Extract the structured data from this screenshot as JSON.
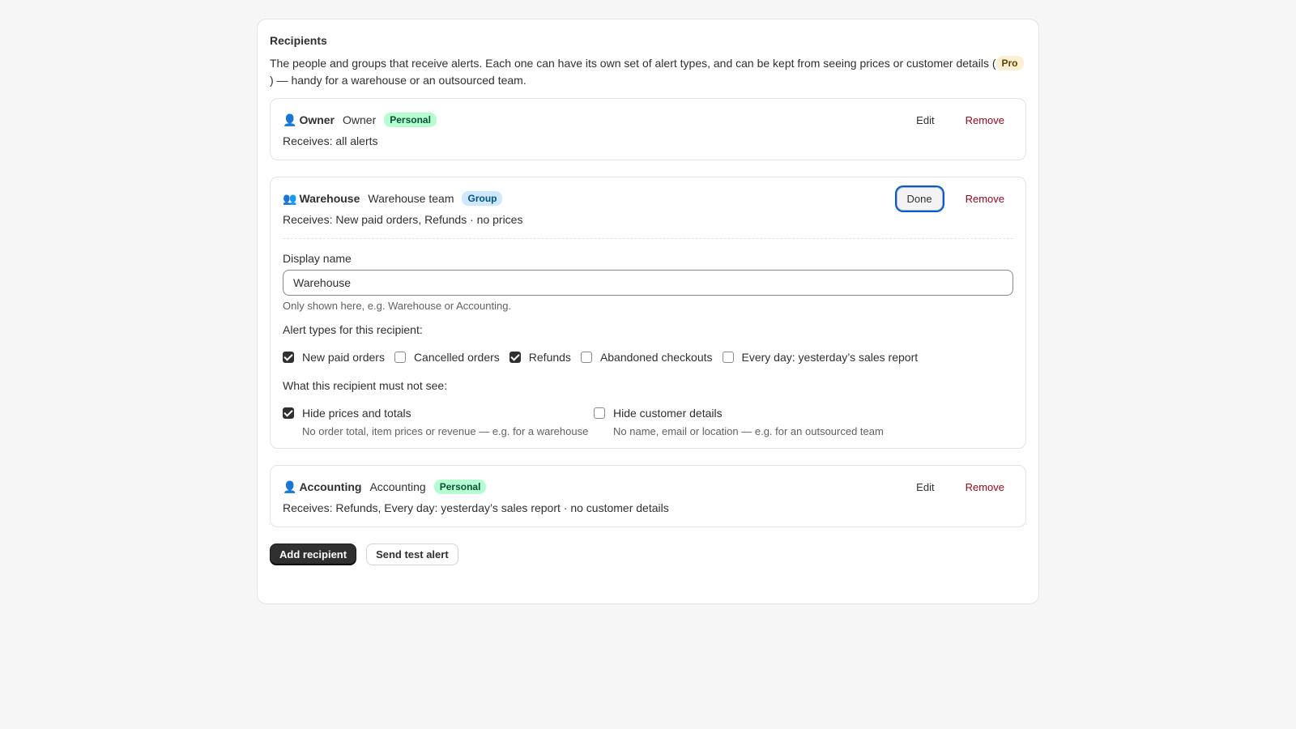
{
  "section": {
    "title": "Recipients",
    "description_before": "The people and groups that receive alerts. Each one can have its own set of alert types, and can be kept from seeing prices or customer details (",
    "pro_badge": "Pro",
    "description_after": ") — handy for a warehouse or an outsourced team."
  },
  "recipients": [
    {
      "icon": "👤",
      "name": "Owner",
      "subtitle": "Owner",
      "badge": "Personal",
      "receives": "Receives: all alerts",
      "edit_label": "Edit",
      "remove_label": "Remove"
    },
    {
      "icon": "👥",
      "name": "Warehouse",
      "subtitle": "Warehouse team",
      "badge": "Group",
      "receives": "Receives: New paid orders, Refunds · no prices",
      "done_label": "Done",
      "remove_label": "Remove"
    },
    {
      "icon": "👤",
      "name": "Accounting",
      "subtitle": "Accounting",
      "badge": "Personal",
      "receives": "Receives: Refunds, Every day: yesterday’s sales report · no customer details",
      "edit_label": "Edit",
      "remove_label": "Remove"
    }
  ],
  "editor": {
    "display_name_label": "Display name",
    "display_name_value": "Warehouse",
    "display_name_help": "Only shown here, e.g. Warehouse or Accounting.",
    "alert_types_label": "Alert types for this recipient:",
    "alert_types": [
      {
        "label": "New paid orders",
        "checked": true
      },
      {
        "label": "Cancelled orders",
        "checked": false
      },
      {
        "label": "Refunds",
        "checked": true
      },
      {
        "label": "Abandoned checkouts",
        "checked": false
      },
      {
        "label": "Every day: yesterday’s sales report",
        "checked": false
      }
    ],
    "hide_label": "What this recipient must not see:",
    "hide_options": [
      {
        "label": "Hide prices and totals",
        "help": "No order total, item prices or revenue — e.g. for a warehouse",
        "checked": true
      },
      {
        "label": "Hide customer details",
        "help": "No name, email or location — e.g. for an outsourced team",
        "checked": false
      }
    ]
  },
  "footer": {
    "add_label": "Add recipient",
    "test_label": "Send test alert"
  }
}
